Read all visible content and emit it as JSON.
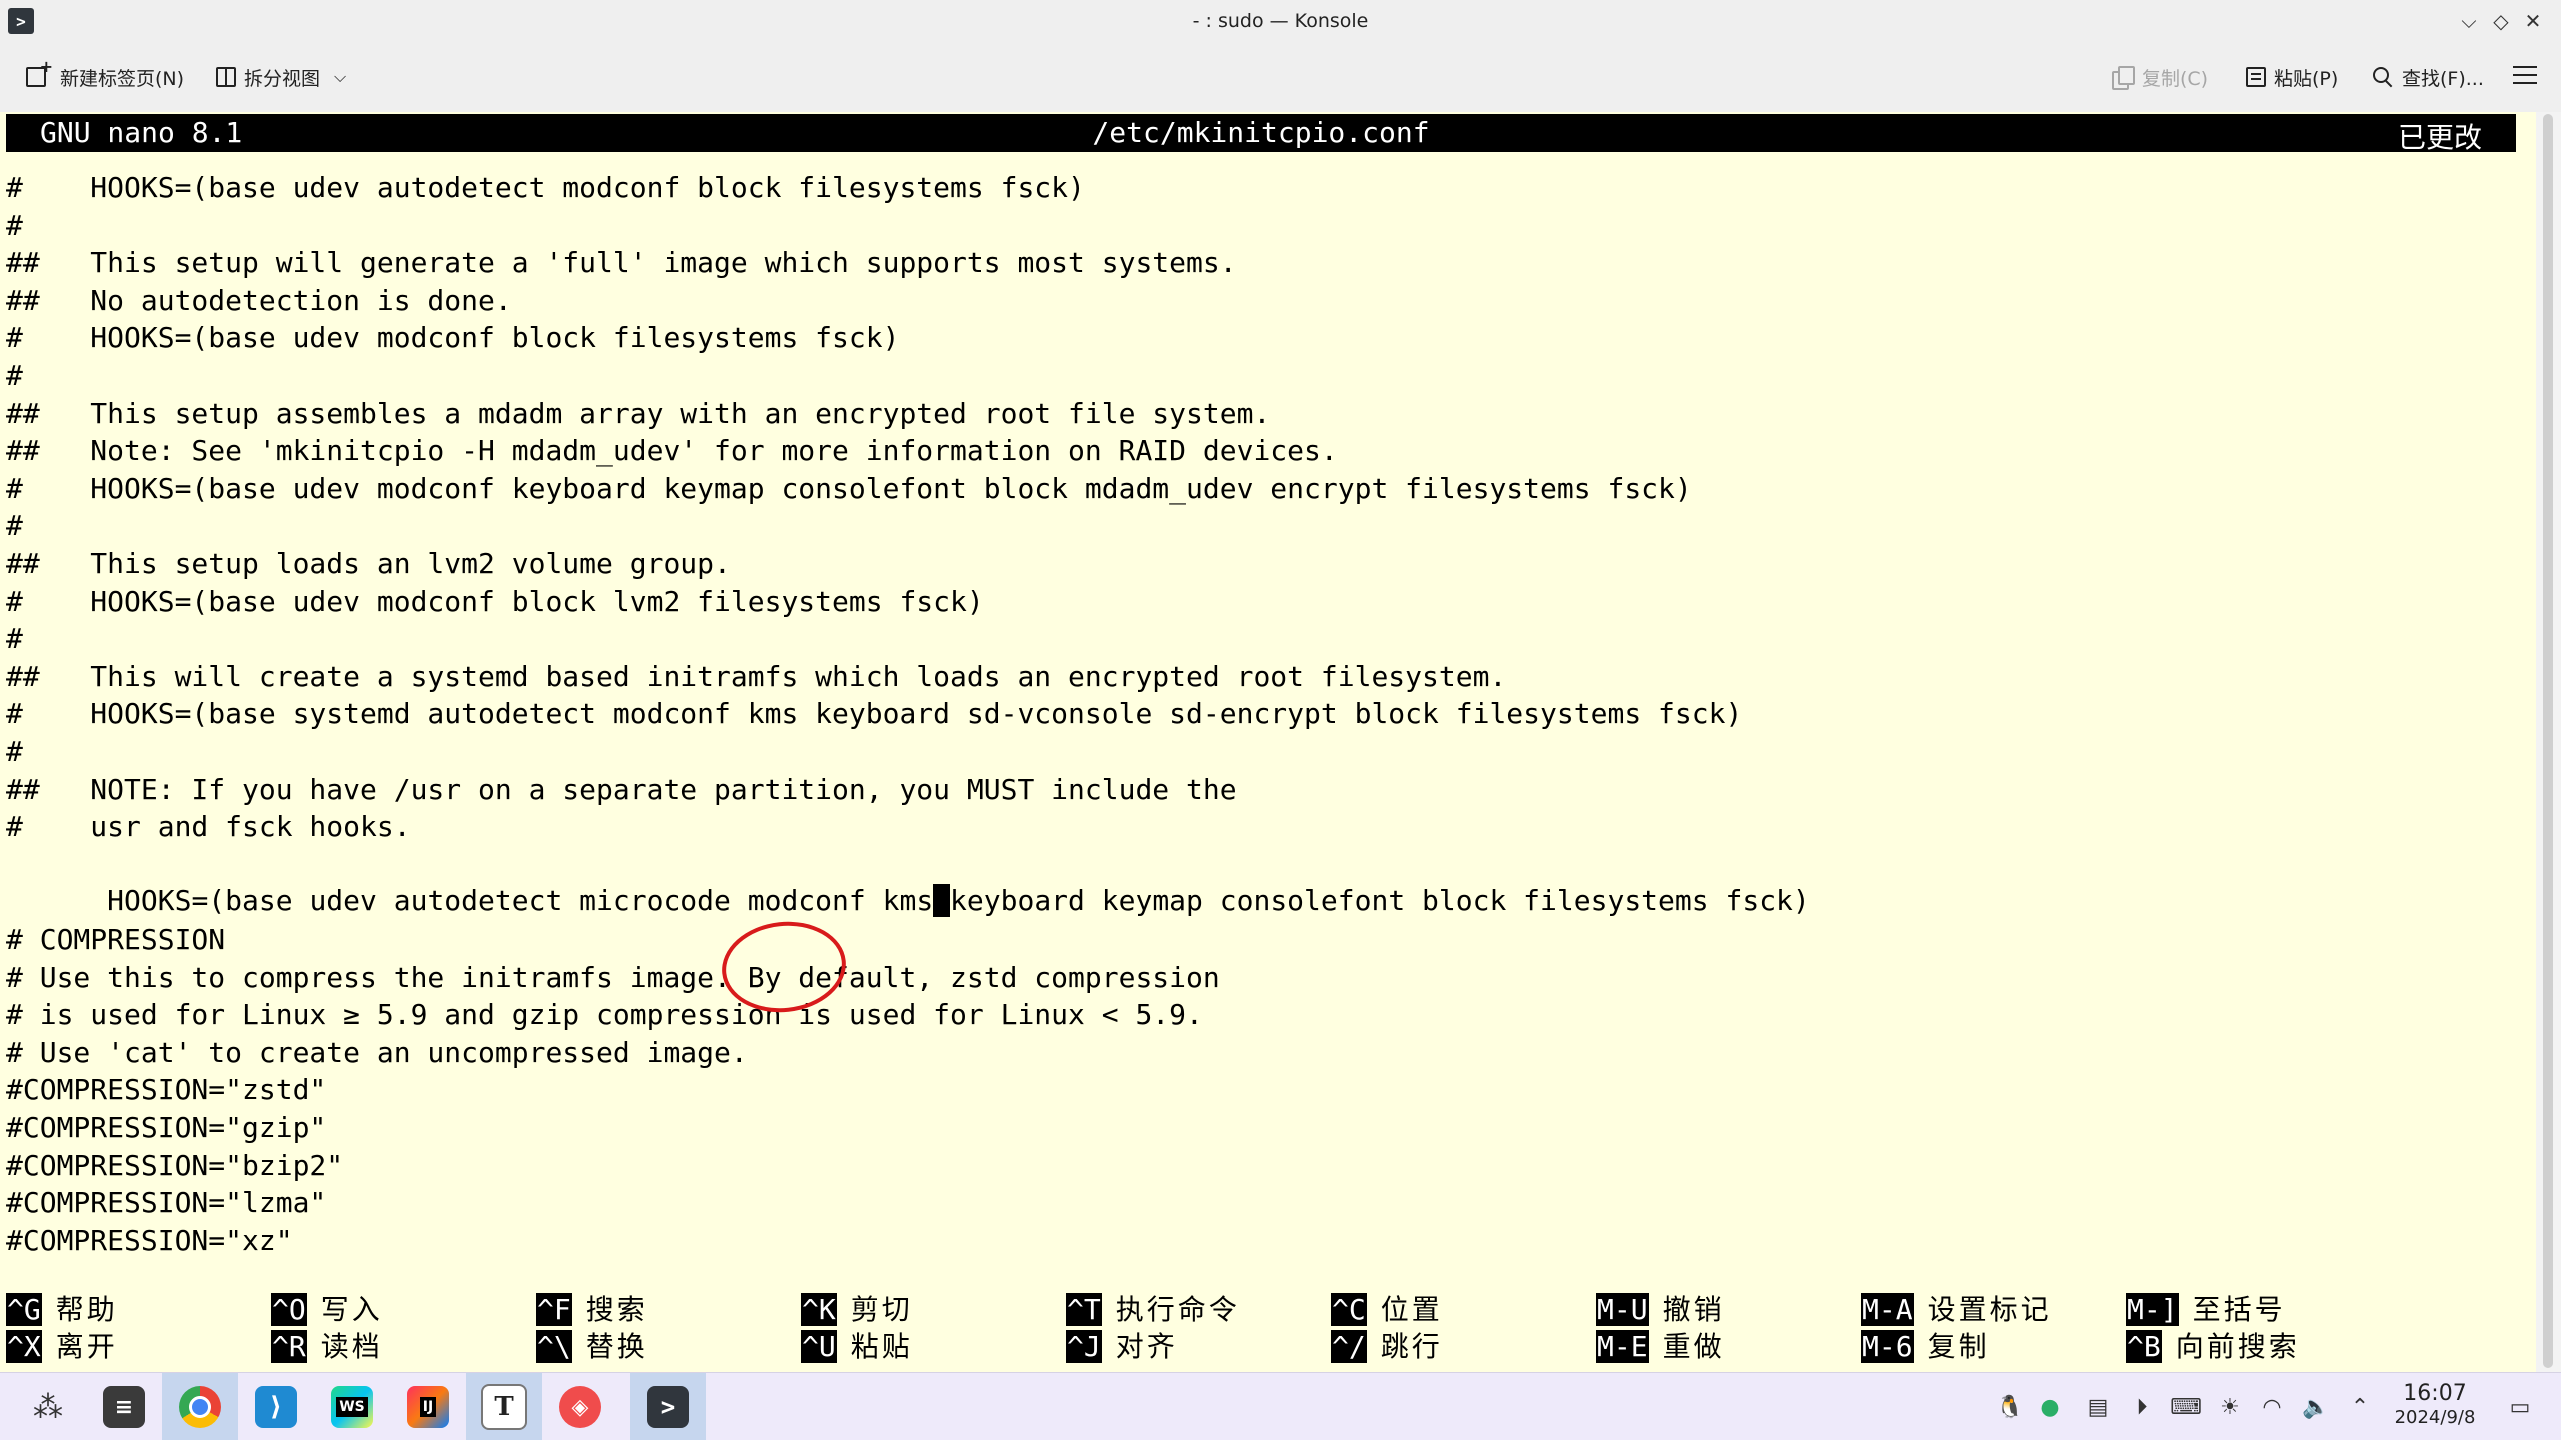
{
  "window": {
    "title": "- : sudo — Konsole"
  },
  "toolbar": {
    "new_tab": "新建标签页(N)",
    "split_view": "拆分视图",
    "copy": "复制(C)",
    "paste": "粘贴(P)",
    "find": "查找(F)..."
  },
  "nano": {
    "version": "GNU nano 8.1",
    "filename": "/etc/mkinitcpio.conf",
    "modified": "已更改"
  },
  "lines": [
    "#    HOOKS=(base udev autodetect modconf block filesystems fsck)",
    "#",
    "##   This setup will generate a 'full' image which supports most systems.",
    "##   No autodetection is done.",
    "#    HOOKS=(base udev modconf block filesystems fsck)",
    "#",
    "##   This setup assembles a mdadm array with an encrypted root file system.",
    "##   Note: See 'mkinitcpio -H mdadm_udev' for more information on RAID devices.",
    "#    HOOKS=(base udev modconf keyboard keymap consolefont block mdadm_udev encrypt filesystems fsck)",
    "#",
    "##   This setup loads an lvm2 volume group.",
    "#    HOOKS=(base udev modconf block lvm2 filesystems fsck)",
    "#",
    "##   This will create a systemd based initramfs which loads an encrypted root filesystem.",
    "#    HOOKS=(base systemd autodetect modconf kms keyboard sd-vconsole sd-encrypt block filesystems fsck)",
    "#",
    "##   NOTE: If you have /usr on a separate partition, you MUST include the",
    "#    usr and fsck hooks."
  ],
  "cursor_line": {
    "before": "HOOKS=(base udev autodetect microcode modconf kms",
    "cursor": " ",
    "after": "keyboard keymap consolefont block filesystems fsck)"
  },
  "lines_after": [
    "",
    "# COMPRESSION",
    "# Use this to compress the initramfs image. By default, zstd compression",
    "# is used for Linux ≥ 5.9 and gzip compression is used for Linux < 5.9.",
    "# Use 'cat' to create an uncompressed image.",
    "#COMPRESSION=\"zstd\"",
    "#COMPRESSION=\"gzip\"",
    "#COMPRESSION=\"bzip2\"",
    "#COMPRESSION=\"lzma\"",
    "#COMPRESSION=\"xz\""
  ],
  "shortcuts": [
    {
      "key": "^G",
      "label": "帮助"
    },
    {
      "key": "^X",
      "label": "离开"
    },
    {
      "key": "^O",
      "label": "写入"
    },
    {
      "key": "^R",
      "label": "读档"
    },
    {
      "key": "^F",
      "label": "搜索"
    },
    {
      "key": "^\\",
      "label": "替换"
    },
    {
      "key": "^K",
      "label": "剪切"
    },
    {
      "key": "^U",
      "label": "粘贴"
    },
    {
      "key": "^T",
      "label": "执行命令"
    },
    {
      "key": "^J",
      "label": "对齐"
    },
    {
      "key": "^C",
      "label": "位置"
    },
    {
      "key": "^/",
      "label": "跳行"
    },
    {
      "key": "M-U",
      "label": "撤销"
    },
    {
      "key": "M-E",
      "label": "重做"
    },
    {
      "key": "M-A",
      "label": "设置标记"
    },
    {
      "key": "M-6",
      "label": "复制"
    },
    {
      "key": "M-]",
      "label": "至括号"
    },
    {
      "key": "^B",
      "label": "向前搜索"
    }
  ],
  "taskbar": {
    "apps": [
      {
        "name": "launcher-icon",
        "glyph": "⋰"
      },
      {
        "name": "system-settings-icon",
        "glyph": "⚙"
      },
      {
        "name": "chrome-icon",
        "glyph": ""
      },
      {
        "name": "vscode-icon",
        "glyph": "⟩"
      },
      {
        "name": "webstorm-icon",
        "glyph": "WS"
      },
      {
        "name": "intellij-icon",
        "glyph": "IJ"
      },
      {
        "name": "typora-icon",
        "glyph": "T"
      },
      {
        "name": "app-red-icon",
        "glyph": "◈"
      },
      {
        "name": "konsole-icon",
        "glyph": ">"
      }
    ],
    "time": "16:07",
    "date": "2024/9/8"
  },
  "colors": {
    "terminal_bg": "#ffffe0",
    "nano_header_bg": "#000000",
    "annotation": "#d81b1b",
    "taskbar_bg": "#eeeafa"
  }
}
